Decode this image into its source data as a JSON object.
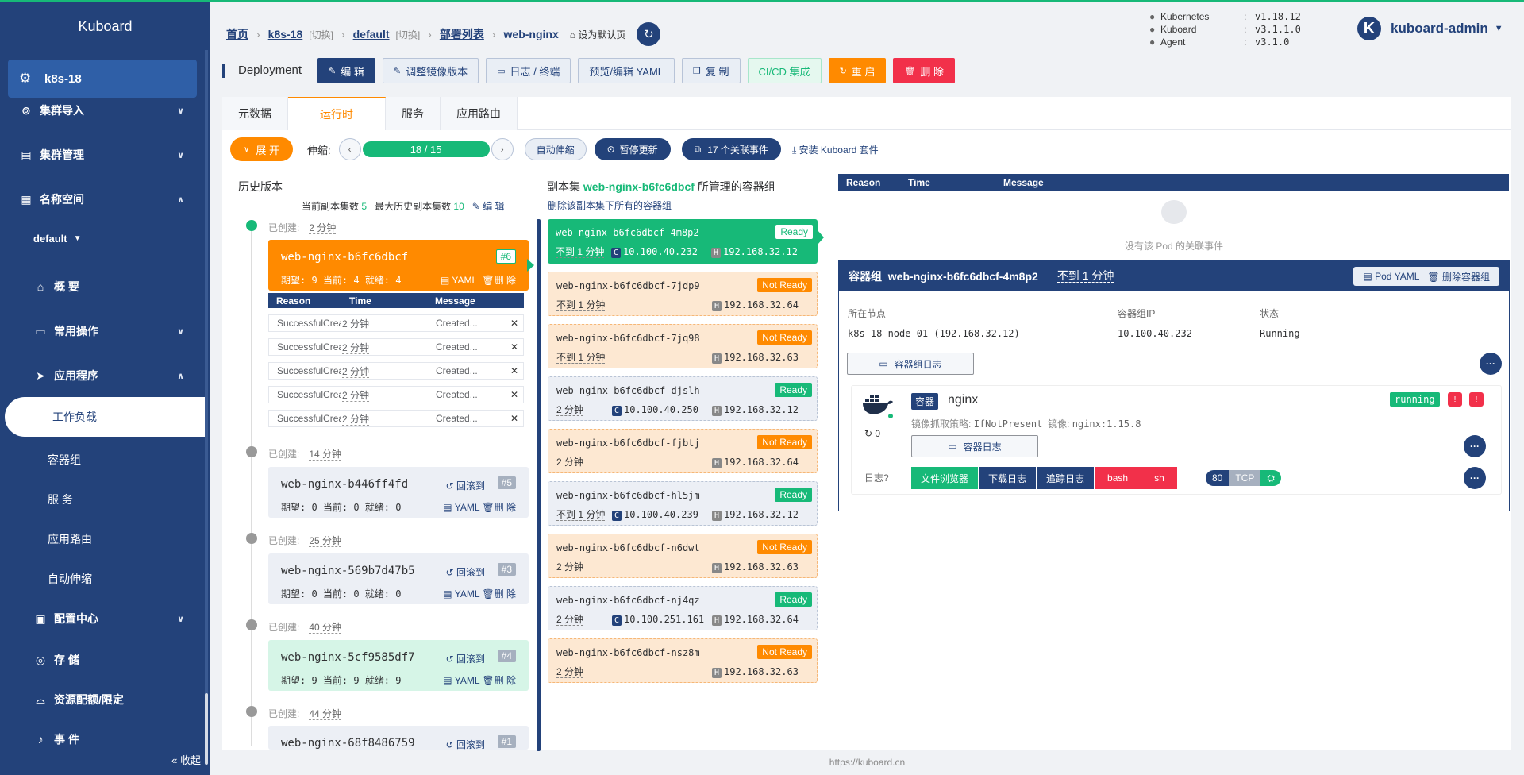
{
  "app_title": "Kuboard",
  "sidebar": {
    "cluster": "k8s-18",
    "items": [
      {
        "label": "集群导入"
      },
      {
        "label": "集群管理"
      },
      {
        "label": "名称空间"
      },
      {
        "label": "default"
      },
      {
        "label": "概 要"
      },
      {
        "label": "常用操作"
      },
      {
        "label": "应用程序"
      },
      {
        "label": "工作负载"
      },
      {
        "label": "容器组"
      },
      {
        "label": "服 务"
      },
      {
        "label": "应用路由"
      },
      {
        "label": "自动伸缩"
      },
      {
        "label": "配置中心"
      },
      {
        "label": "存 储"
      },
      {
        "label": "资源配额/限定"
      },
      {
        "label": "事 件"
      }
    ],
    "collapse": "« 收起"
  },
  "breadcrumb": {
    "home": "首页",
    "cluster": "k8s-18",
    "switch1": "[切换]",
    "namespace": "default",
    "switch2": "[切换]",
    "list": "部署列表",
    "current": "web-nginx",
    "set_default": "设为默认页"
  },
  "versions": [
    {
      "k": "Kubernetes",
      "v": "v1.18.12"
    },
    {
      "k": "Kuboard",
      "v": "v3.1.1.0"
    },
    {
      "k": "Agent",
      "v": "v3.1.0"
    }
  ],
  "user": {
    "avatar": "K",
    "name": "kuboard-admin"
  },
  "toolbar": {
    "title": "Deployment",
    "edit": "编 辑",
    "adjust_image": "调整镜像版本",
    "logs": "日志 / 终端",
    "yaml": "预览/编辑 YAML",
    "copy": "复 制",
    "cicd": "CI/CD 集成",
    "restart": "重 启",
    "delete": "删 除"
  },
  "tabs": [
    "元数据",
    "运行时",
    "服务",
    "应用路由"
  ],
  "controls": {
    "expand": "展 开",
    "scale_label": "伸缩:",
    "scale_value": "18 / 15",
    "autoscale": "自动伸缩",
    "pause": "暂停更新",
    "events": "17 个关联事件",
    "install": "安装 Kuboard 套件"
  },
  "history": {
    "title": "历史版本",
    "current_count_label": "当前副本集数",
    "current_count": "5",
    "max_count_label": "最大历史副本集数",
    "max_count": "10",
    "edit": "编 辑",
    "created_label": "已创建:",
    "rollback": "回滚到",
    "yaml": "YAML",
    "delete": "删 除",
    "entries": [
      {
        "age": "2 分钟",
        "name": "web-nginx-b6fc6dbcf",
        "rev": "#6",
        "meta": "期望: 9 当前: 4 就绪: 4"
      },
      {
        "age": "14 分钟",
        "name": "web-nginx-b446ff4fd",
        "rev": "#5",
        "meta": "期望: 0 当前: 0 就绪: 0"
      },
      {
        "age": "25 分钟",
        "name": "web-nginx-569b7d47b5",
        "rev": "#3",
        "meta": "期望: 0 当前: 0 就绪: 0"
      },
      {
        "age": "40 分钟",
        "name": "web-nginx-5cf9585df7",
        "rev": "#4",
        "meta": "期望: 9 当前: 9 就绪: 9"
      },
      {
        "age": "44 分钟",
        "name": "web-nginx-68f8486759",
        "rev": "#1"
      }
    ],
    "event_head": {
      "reason": "Reason",
      "time": "Time",
      "message": "Message"
    },
    "events": [
      {
        "reason": "SuccessfulCreate",
        "time": "2 分钟",
        "message": "Created..."
      },
      {
        "reason": "SuccessfulCreate",
        "time": "2 分钟",
        "message": "Created..."
      },
      {
        "reason": "SuccessfulCreate",
        "time": "2 分钟",
        "message": "Created..."
      },
      {
        "reason": "SuccessfulCreate",
        "time": "2 分钟",
        "message": "Created..."
      },
      {
        "reason": "SuccessfulCreate",
        "time": "2 分钟",
        "message": "Created..."
      }
    ]
  },
  "replicaset": {
    "title_pre": "副本集",
    "title_name": "web-nginx-b6fc6dbcf",
    "title_post": "所管理的容器组",
    "delete_all": "删除该副本集下所有的容器组",
    "pods": [
      {
        "name": "web-nginx-b6fc6dbcf-4m8p2",
        "status": "Ready",
        "age": "不到 1 分钟",
        "cip": "10.100.40.232",
        "hip": "192.168.32.12"
      },
      {
        "name": "web-nginx-b6fc6dbcf-7jdp9",
        "status": "Not Ready",
        "age": "不到 1 分钟",
        "cip": "",
        "hip": "192.168.32.64"
      },
      {
        "name": "web-nginx-b6fc6dbcf-7jq98",
        "status": "Not Ready",
        "age": "不到 1 分钟",
        "cip": "",
        "hip": "192.168.32.63"
      },
      {
        "name": "web-nginx-b6fc6dbcf-djslh",
        "status": "Ready",
        "age": "2 分钟",
        "cip": "10.100.40.250",
        "hip": "192.168.32.12"
      },
      {
        "name": "web-nginx-b6fc6dbcf-fjbtj",
        "status": "Not Ready",
        "age": "2 分钟",
        "cip": "",
        "hip": "192.168.32.64"
      },
      {
        "name": "web-nginx-b6fc6dbcf-hl5jm",
        "status": "Ready",
        "age": "不到 1 分钟",
        "cip": "10.100.40.239",
        "hip": "192.168.32.12"
      },
      {
        "name": "web-nginx-b6fc6dbcf-n6dwt",
        "status": "Not Ready",
        "age": "2 分钟",
        "cip": "",
        "hip": "192.168.32.63"
      },
      {
        "name": "web-nginx-b6fc6dbcf-nj4qz",
        "status": "Ready",
        "age": "2 分钟",
        "cip": "10.100.251.161",
        "hip": "192.168.32.64"
      },
      {
        "name": "web-nginx-b6fc6dbcf-nsz8m",
        "status": "Not Ready",
        "age": "2 分钟",
        "cip": "",
        "hip": "192.168.32.63"
      }
    ]
  },
  "pod_events": {
    "reason": "Reason",
    "time": "Time",
    "message": "Message",
    "empty": "没有该 Pod 的关联事件"
  },
  "pod_detail": {
    "label": "容器组",
    "name": "web-nginx-b6fc6dbcf-4m8p2",
    "age": "不到 1 分钟",
    "pod_yaml": "Pod YAML",
    "delete": "删除容器组",
    "node_label": "所在节点",
    "node_value": "k8s-18-node-01 (192.168.32.12)",
    "ip_label": "容器组IP",
    "ip_value": "10.100.40.232",
    "status_label": "状态",
    "status_value": "Running",
    "pod_logs": "容器组日志",
    "container": {
      "tag": "容器",
      "name": "nginx",
      "state": "running",
      "policy_label": "镜像抓取策略:",
      "policy": "IfNotPresent",
      "image_label": "镜像:",
      "image": "nginx:1.15.8",
      "restarts": "0",
      "logs": "容器日志",
      "log_label": "日志",
      "log_buttons": [
        "文件浏览器",
        "下载日志",
        "追踪日志",
        "bash",
        "sh"
      ],
      "port": "80",
      "protocol": "TCP"
    }
  },
  "footer": "https://kuboard.cn",
  "colors": {
    "primary": "#23427a",
    "green": "#17b978",
    "orange": "#ff8a00",
    "red": "#f2304a"
  }
}
